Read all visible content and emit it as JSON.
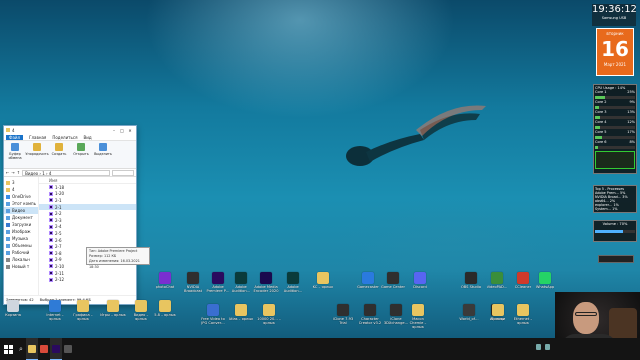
{
  "explorer": {
    "title": "4",
    "window_buttons": [
      "–",
      "□",
      "✕"
    ],
    "tabs": [
      "Файл",
      "Главная",
      "Поделиться",
      "Вид"
    ],
    "ribbon": [
      {
        "label": "Буфер обмена",
        "icon": "clipboard-icon",
        "color": "#4a8fd9"
      },
      {
        "label": "Упорядочить",
        "icon": "organize-icon",
        "color": "#e0b23c"
      },
      {
        "label": "Создать",
        "icon": "new-folder-icon",
        "color": "#e0b23c"
      },
      {
        "label": "Открыть",
        "icon": "open-icon",
        "color": "#5aa85a"
      },
      {
        "label": "Выделить",
        "icon": "select-icon",
        "color": "#4a8fd9"
      }
    ],
    "address": "Видео › 1 › 4",
    "nav": [
      {
        "label": "3",
        "color": "#e8c560"
      },
      {
        "label": "4",
        "color": "#e8c560"
      },
      {
        "label": "OneDrive",
        "color": "#3a8ee6"
      },
      {
        "label": "Этот компь",
        "color": "#5aa0e0"
      },
      {
        "label": "Видео",
        "color": "#5aa0e0",
        "selected": true
      },
      {
        "label": "Документ",
        "color": "#5aa0e0"
      },
      {
        "label": "Загрузки",
        "color": "#3a7ad0"
      },
      {
        "label": "Изображ",
        "color": "#5aa0e0"
      },
      {
        "label": "Музыка",
        "color": "#5aa0e0"
      },
      {
        "label": "Объемны",
        "color": "#5aa0e0"
      },
      {
        "label": "Рабочий",
        "color": "#5aa0e0"
      },
      {
        "label": "Локальн",
        "color": "#888888"
      },
      {
        "label": "Новый т",
        "color": "#888888"
      }
    ],
    "list_header": "Имя",
    "files": [
      "1-18",
      "1-20",
      "2-1",
      "2-1",
      "2-2",
      "2-3",
      "2-4",
      "2-5",
      "2-6",
      "2-7",
      "2-8",
      "2-9",
      "2-10",
      "2-11",
      "2-12"
    ],
    "selected_index": 3,
    "status_count": "Элементов: 42",
    "status_selected": "Выбран 1 элемент: 99,4 КБ"
  },
  "tooltip": {
    "type": "Тип: Adobe Premiere Project",
    "size": "Размер: 112 КБ",
    "modified": "Дата изменения: 16.03.2021 18:30"
  },
  "desktop_icons": [
    {
      "label": "Корзина",
      "color": "#cfd6de"
    },
    {
      "label": "Internet – ярлык",
      "color": "#2f7bd6"
    },
    {
      "label": "Графика – ярлык",
      "color": "#e8c560"
    },
    {
      "label": "Игры – ярлык",
      "color": "#e8c560"
    },
    {
      "label": "Видео – ярлык",
      "color": "#e8c560"
    },
    {
      "label": "5.8 – ярлык",
      "color": "#e8c560"
    },
    {
      "label": "photoChat",
      "color": "#7a2fd0"
    },
    {
      "label": "NVIDIA Broadcast",
      "color": "#2f2f2f"
    },
    {
      "label": "Adobe Premiere P…",
      "color": "#2a0a5e"
    },
    {
      "label": "Adobe Audition…",
      "color": "#0a3b3b"
    },
    {
      "label": "Adobe Media Encoder 2020",
      "color": "#1a0a4e"
    },
    {
      "label": "Adobe Audition…",
      "color": "#0a3b3b"
    },
    {
      "label": "KC – ярлык",
      "color": "#e8c560"
    },
    {
      "label": "Free Video to JPG Conver…",
      "color": "#3a6ed0"
    },
    {
      "label": "Atlas – ярлык",
      "color": "#e8c560"
    },
    {
      "label": "10000 20… – ярлык",
      "color": "#e8c560"
    },
    {
      "label": "iClone 7.93 Trial",
      "color": "#2f2f2f"
    },
    {
      "label": "Character Creator v3.2",
      "color": "#2f2f2f"
    },
    {
      "label": "iClone 3DXchange…",
      "color": "#2f2f2f"
    },
    {
      "label": "Gamecaster",
      "color": "#2a7adf"
    },
    {
      "label": "Game Center",
      "color": "#2f2f2f"
    },
    {
      "label": "Macon Chemie – ярлык",
      "color": "#e8c560"
    },
    {
      "label": "Discord",
      "color": "#5865f2"
    },
    {
      "label": "World_of…",
      "color": "#3a3a3a"
    },
    {
      "label": "Winamp",
      "color": "#2a2a2a"
    },
    {
      "label": "OBS Studio",
      "color": "#2a2a2a"
    },
    {
      "label": "VideoPAD…",
      "color": "#3a8e3a"
    },
    {
      "label": "Ethernet – ярлык",
      "color": "#e8c560"
    },
    {
      "label": "CCleaner",
      "color": "#cf3a2a"
    },
    {
      "label": "Ярлыки",
      "color": "#e8c560"
    },
    {
      "label": "WhatsApp",
      "color": "#25d366"
    }
  ],
  "clock": {
    "time": "19:36:12",
    "sub": "Samsung USB"
  },
  "calendar": {
    "dow": "вторник",
    "day": "16",
    "month_year": "Март 2021"
  },
  "cpu": {
    "title": "CPU Usage : 14%",
    "cores": [
      {
        "label": "Core 1",
        "value": "25%",
        "fill": 0.25
      },
      {
        "label": "Core 2",
        "value": "9%",
        "fill": 0.09
      },
      {
        "label": "Core 3",
        "value": "13%",
        "fill": 0.13
      },
      {
        "label": "Core 4",
        "value": "12%",
        "fill": 0.12
      },
      {
        "label": "Core 5",
        "value": "17%",
        "fill": 0.17
      },
      {
        "label": "Core 6",
        "value": "8%",
        "fill": 0.08
      }
    ]
  },
  "top5": {
    "title": "Top 5 - Processes",
    "rows": [
      "Adobe Prem… 5%",
      "NVIDIA Broad… 3%",
      "obs64… 2%",
      "explorer… 1%",
      "System… 1%"
    ]
  },
  "volume": {
    "label": "Volume : 70%",
    "fill": 0.7
  },
  "taskbar": {
    "apps": [
      {
        "name": "explorer",
        "color": "#e8c560",
        "active": true
      },
      {
        "name": "chrome",
        "color": "#d94a3a",
        "active": false
      },
      {
        "name": "premiere",
        "color": "#2a0a5e",
        "active": true
      },
      {
        "name": "obs",
        "color": "#555555",
        "active": false
      }
    ]
  }
}
